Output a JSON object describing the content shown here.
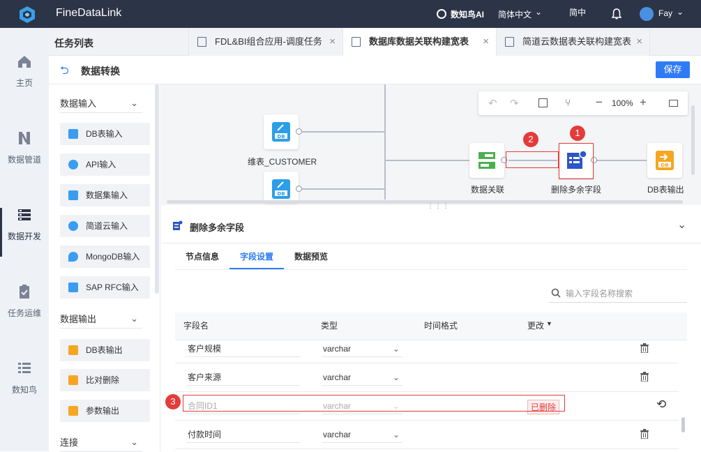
{
  "app": {
    "name": "FineDataLink",
    "ai_label": "数知鸟AI",
    "lang_label": "简体中文",
    "lang_short": "简中",
    "user": "Fay"
  },
  "nav": [
    {
      "label": "主页",
      "icon": "home-icon"
    },
    {
      "label": "数据管道",
      "icon": "pipeline-icon"
    },
    {
      "label": "数据开发",
      "icon": "dev-icon"
    },
    {
      "label": "任务运维",
      "icon": "ops-icon"
    },
    {
      "label": "数知鸟",
      "icon": "list-icon"
    }
  ],
  "tasks_title": "任务列表",
  "tabs": [
    "FDL&BI组合应用-调度任务",
    "数据库数据关联构建宽表",
    "简道云数据表关联构建宽表"
  ],
  "page_title": "数据转换",
  "save_label": "保存",
  "palette": {
    "input_title": "数据输入",
    "inputs": [
      "DB表输入",
      "API输入",
      "数据集输入",
      "简道云输入",
      "MongoDB输入",
      "SAP RFC输入"
    ],
    "output_title": "数据输出",
    "outputs": [
      "DB表输出",
      "比对删除",
      "参数输出"
    ],
    "connect_title": "连接"
  },
  "toolbar": {
    "zoom": "100%"
  },
  "nodes": {
    "customer": "维表_CUSTOMER",
    "join": "数据关联",
    "delete": "删除多余字段",
    "output": "DB表输出"
  },
  "badges": [
    "1",
    "2",
    "3"
  ],
  "panel": {
    "title": "删除多余字段",
    "tabs": [
      "节点信息",
      "字段设置",
      "数据预览"
    ],
    "search_placeholder": "输入字段名称搜索",
    "headers": [
      "字段名",
      "类型",
      "时间格式",
      "更改"
    ],
    "rows": [
      {
        "name": "客户规模",
        "type": "varchar"
      },
      {
        "name": "客户来源",
        "type": "varchar"
      },
      {
        "name": "合同ID1",
        "type": "varchar",
        "status": "已删除"
      },
      {
        "name": "付款时间",
        "type": "varchar"
      }
    ]
  },
  "colors": {
    "accent": "#2f7bf5",
    "topbar": "#2c3447",
    "red": "#e43b3b",
    "green": "#4caf50",
    "orange": "#f5a623"
  }
}
